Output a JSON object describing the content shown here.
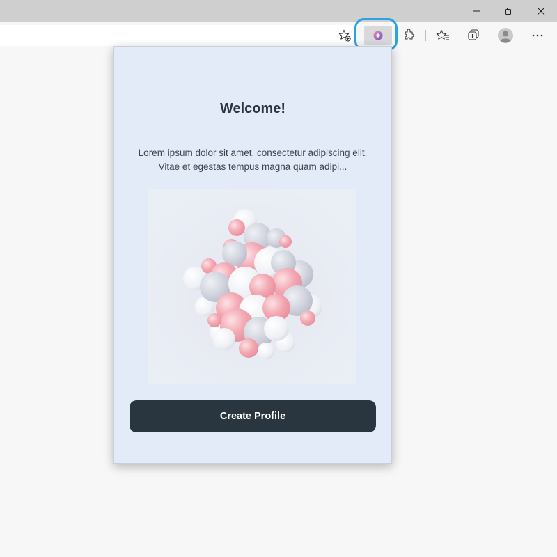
{
  "window": {
    "controls": [
      "minimize",
      "restore",
      "close"
    ]
  },
  "toolbar": {
    "icons": [
      "favorite-add-icon",
      "extension-popup-icon",
      "extensions-icon",
      "favorites-icon",
      "collections-icon",
      "profile-icon",
      "more-icon"
    ],
    "highlight_color": "#2aa3e0"
  },
  "popup": {
    "title": "Welcome!",
    "description": "Lorem ipsum dolor sit amet, consectetur adipiscing elit. Vitae et egestas tempus magna quam adipi...",
    "button_label": "Create Profile",
    "colors": {
      "background": "#e4ebf8",
      "button": "#29363f",
      "title": "#2b3540",
      "art_pink": "#f3a9b3",
      "art_white": "#f4f6fa",
      "art_gray": "#c9ccd6"
    }
  }
}
